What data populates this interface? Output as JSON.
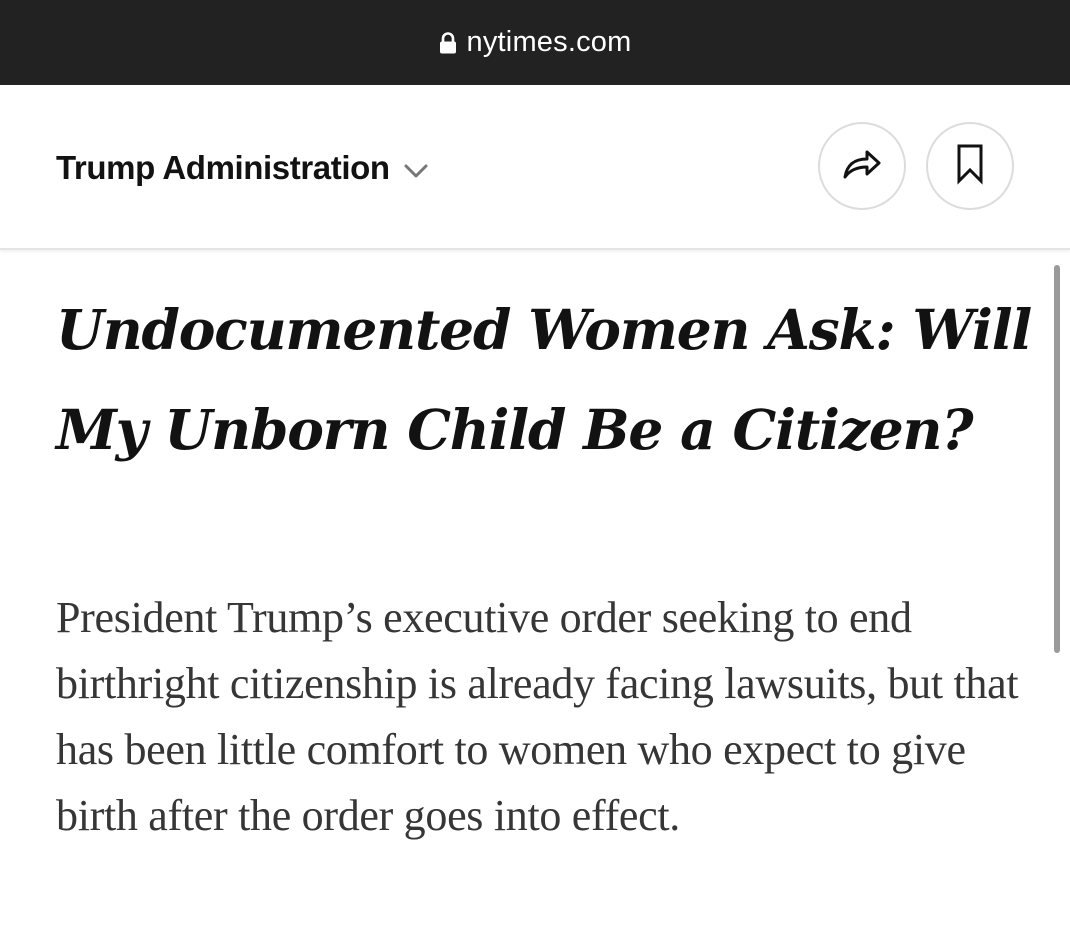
{
  "browser": {
    "url": "nytimes.com",
    "lock_icon": "lock-icon"
  },
  "section": {
    "label": "Trump Administration",
    "dropdown_icon": "chevron-down-icon",
    "share_icon": "share-arrow-icon",
    "save_icon": "bookmark-icon"
  },
  "article": {
    "headline": "Undocumented Women Ask: Will My Unborn Child Be a Citizen?",
    "summary": "President Trump’s executive order seeking to end birthright citizenship is already facing lawsuits, but that has been little comfort to women who expect to give birth after the order goes into effect."
  },
  "colors": {
    "address_bar_bg": "#222222",
    "text_primary": "#121212",
    "text_summary": "#363636"
  }
}
